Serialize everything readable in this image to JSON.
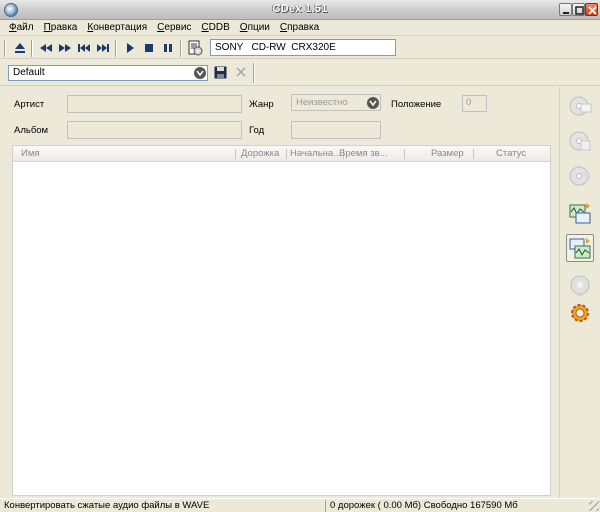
{
  "window": {
    "title": "CDex 1.51"
  },
  "menu": {
    "items": [
      "Файл",
      "Правка",
      "Конвертация",
      "Сервис",
      "CDDB",
      "Опции",
      "Справка"
    ]
  },
  "toolbar": {
    "drive": "SONY   CD-RW  CRX320E",
    "buttons": [
      "eject-icon",
      "rewind-icon",
      "fast-forward-icon",
      "previous-track-icon",
      "next-track-icon",
      "play-icon",
      "stop-icon",
      "pause-icon",
      "cd-info-icon"
    ]
  },
  "profile": {
    "selected": "Default"
  },
  "fields": {
    "artist_label": "Артист",
    "album_label": "Альбом",
    "genre_label": "Жанр",
    "genre_value": "Неизвестно",
    "year_label": "Год",
    "position_label": "Положение",
    "position_value": "0"
  },
  "track_list": {
    "columns": [
      "Имя",
      "Дорожка",
      "Начальна...",
      "Время зв...",
      "Размер",
      "Статус"
    ],
    "rows": []
  },
  "sidebar": {
    "buttons": [
      "extract-cd-to-wav-icon",
      "extract-cd-to-compressed-icon",
      "extract-partial-track-icon",
      "convert-wav-to-compressed-icon",
      "convert-compressed-to-wav-icon",
      "record-icon",
      "settings-icon"
    ]
  },
  "status": {
    "left": "Конвертировать сжатые аудио файлы в WAVE",
    "right": "0 дорожек ( 0.00 Мб) Свободно 167590 Мб"
  },
  "colors": {
    "titlebar": "#c9c9c9",
    "background": "#ece9d8",
    "field_border": "#7f9db9",
    "close_button": "#c9421f"
  }
}
